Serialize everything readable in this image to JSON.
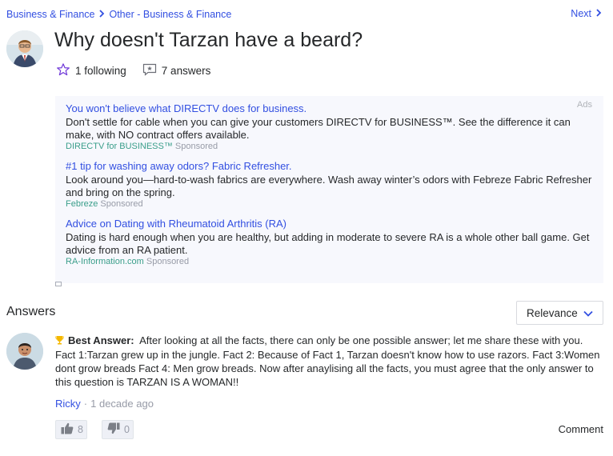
{
  "breadcrumb": {
    "category": "Business & Finance",
    "subcategory": "Other - Business & Finance",
    "next_label": "Next"
  },
  "question": {
    "title": "Why doesn't Tarzan have a beard?",
    "following_label": "1 following",
    "answers_label": "7 answers"
  },
  "ads": {
    "label": "Ads",
    "items": [
      {
        "title": "You won't believe what DIRECTV does for business.",
        "body": "Don't settle for cable when you can give your customers DIRECTV for BUSINESS™. See the difference it can make, with NO contract offers available.",
        "source": "DIRECTV for BUSINESS™",
        "sponsored": "Sponsored"
      },
      {
        "title": "#1 tip for washing away odors? Fabric Refresher.",
        "body": "Look around you—hard-to-wash fabrics are everywhere. Wash away winter’s odors with Febreze Fabric Refresher and bring on the spring.",
        "source": "Febreze",
        "sponsored": "Sponsored"
      },
      {
        "title": "Advice on Dating with Rheumatoid Arthritis (RA)",
        "body": "Dating is hard enough when you are healthy, but adding in moderate to severe RA is a whole other ball game. Get advice from an RA patient.",
        "source": "RA-Information.com",
        "sponsored": "Sponsored"
      }
    ]
  },
  "answers": {
    "heading": "Answers",
    "sort_label": "Relevance",
    "best": {
      "label": "Best Answer:",
      "text": "After looking at all the facts, there can only be one possible answer; let me share these with you. Fact 1:Tarzan grew up in the jungle. Fact 2: Because of Fact 1, Tarzan doesn't know how to use razors. Fact 3:Women dont grow breads Fact 4: Men grow breads. Now after anaylising all the facts, you must agree that the only answer to this question is TARZAN IS A WOMAN!!",
      "author": "Ricky",
      "time": "1 decade ago",
      "upvotes": "8",
      "downvotes": "0",
      "comment_label": "Comment"
    }
  },
  "colors": {
    "link": "#324fe1",
    "ad_background": "#f7f8fd",
    "source_green": "#3a9e8a",
    "star_purple": "#6e36d8",
    "trophy_gold": "#f5b800"
  }
}
